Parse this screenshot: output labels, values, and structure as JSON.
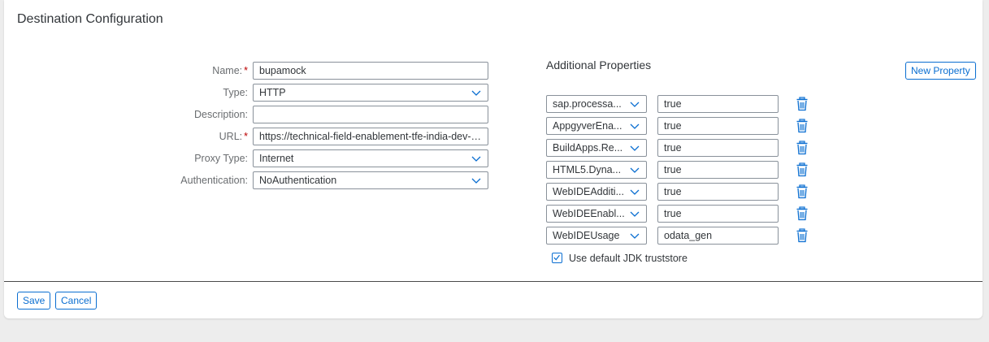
{
  "title": "Destination Configuration",
  "form": {
    "name": {
      "label": "Name:",
      "required": true,
      "value": "bupamock"
    },
    "type": {
      "label": "Type:",
      "value": "HTTP"
    },
    "description": {
      "label": "Description:",
      "value": ""
    },
    "url": {
      "label": "URL:",
      "required": true,
      "value": "https://technical-field-enablement-tfe-india-dev-de..."
    },
    "proxy_type": {
      "label": "Proxy Type:",
      "value": "Internet"
    },
    "authentication": {
      "label": "Authentication:",
      "value": "NoAuthentication"
    }
  },
  "required_marker": "*",
  "additional_properties": {
    "title": "Additional Properties",
    "new_property_label": "New Property",
    "rows": [
      {
        "key": "sap.processa...",
        "value": "true"
      },
      {
        "key": "AppgyverEna...",
        "value": "true"
      },
      {
        "key": "BuildApps.Re...",
        "value": "true"
      },
      {
        "key": "HTML5.Dyna...",
        "value": "true"
      },
      {
        "key": "WebIDEAdditi...",
        "value": "true"
      },
      {
        "key": "WebIDEEnabl...",
        "value": "true"
      },
      {
        "key": "WebIDEUsage",
        "value": "odata_gen"
      }
    ],
    "jdk_truststore": {
      "label": "Use default JDK truststore",
      "checked": true
    }
  },
  "footer": {
    "save_label": "Save",
    "cancel_label": "Cancel"
  },
  "icons": {
    "dropdown": "chevron-down-icon",
    "delete": "trash-icon",
    "check": "checkmark-icon"
  },
  "colors": {
    "accent": "#0a6ed1",
    "required": "#bb0000",
    "background": "#ededed"
  }
}
